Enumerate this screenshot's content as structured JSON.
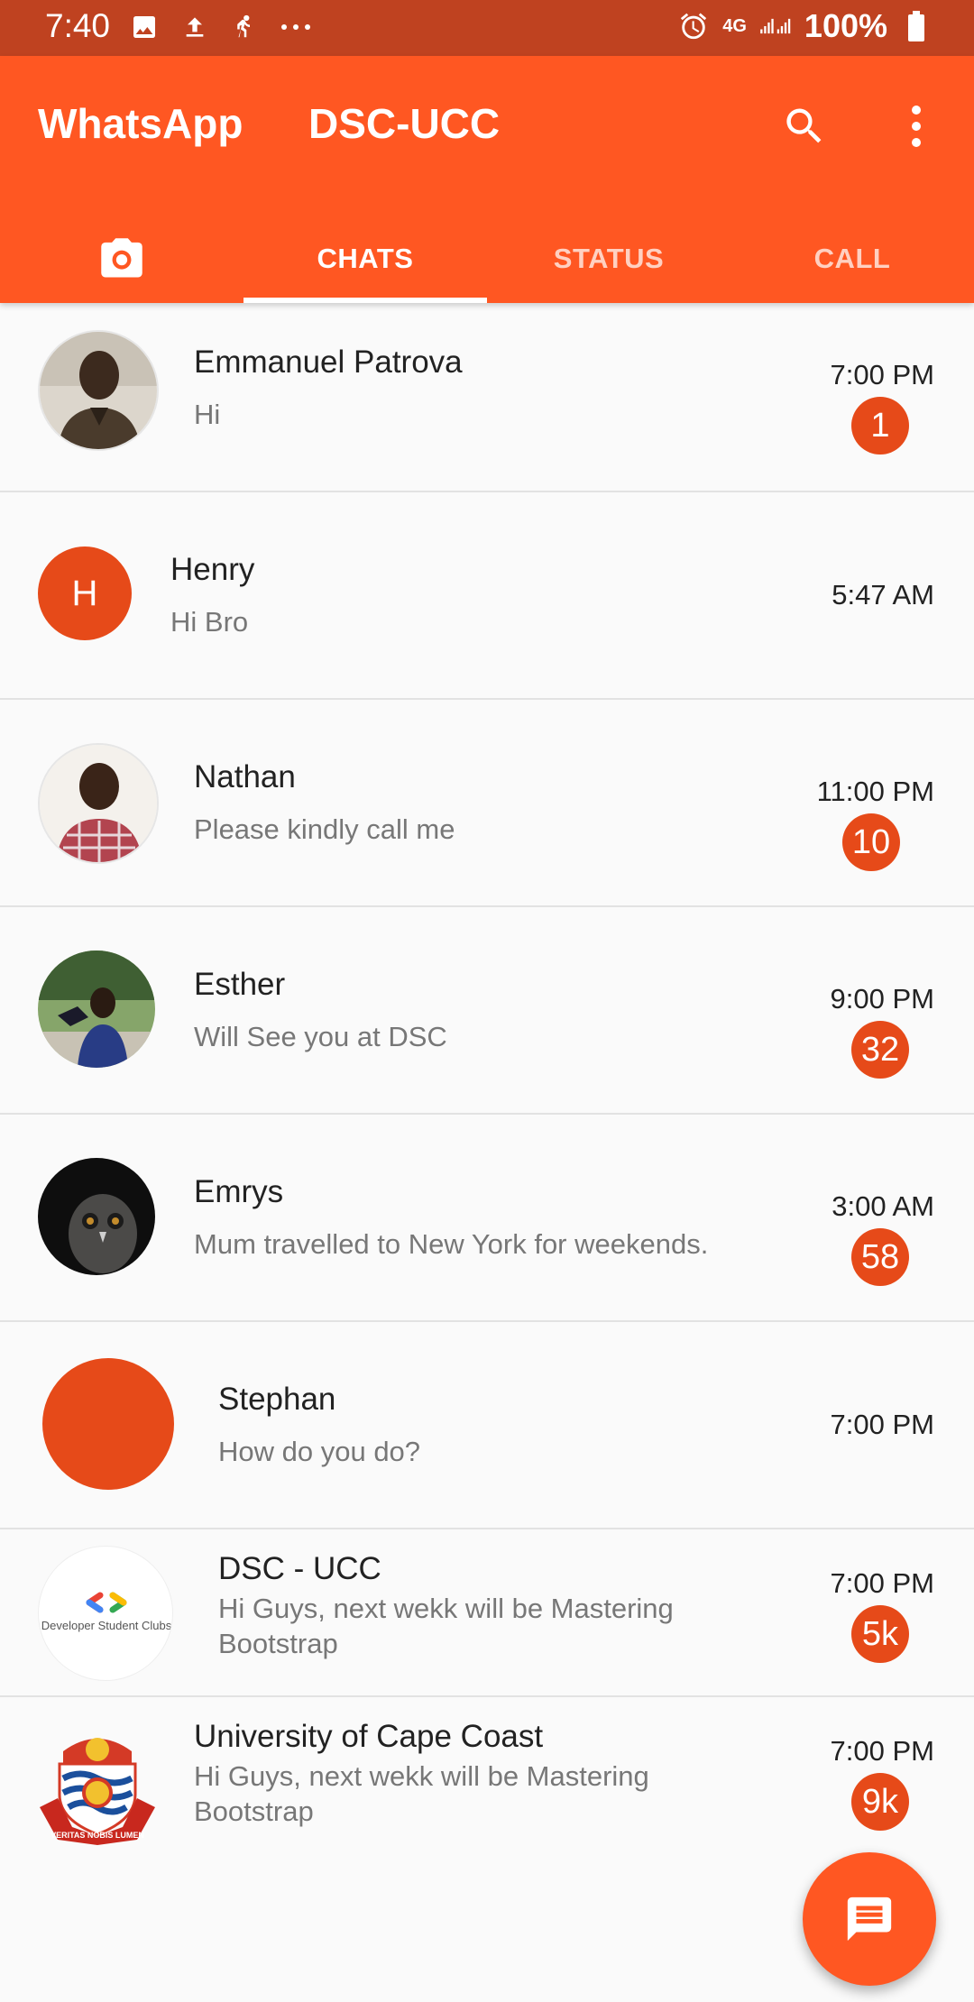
{
  "status_bar": {
    "time": "7:40",
    "network": "4G",
    "battery": "100%",
    "icons": [
      "image-icon",
      "upload-icon",
      "accessibility-icon",
      "more-dots-icon",
      "alarm-icon",
      "signal-icon",
      "battery-icon"
    ]
  },
  "header": {
    "app_name": "WhatsApp",
    "group_name": "DSC-UCC",
    "icons": [
      "search-icon",
      "more-vert-icon"
    ]
  },
  "tabs": [
    {
      "label": "",
      "icon": "camera-icon"
    },
    {
      "label": "CHATS",
      "active": true
    },
    {
      "label": "STATUS"
    },
    {
      "label": "CALL"
    }
  ],
  "chats": [
    {
      "name": "Emmanuel Patrova",
      "message": "Hi",
      "time": "7:00 PM",
      "unread": "1"
    },
    {
      "name": "Henry",
      "message": "Hi Bro",
      "time": "5:47 AM",
      "initial": "H"
    },
    {
      "name": "Nathan",
      "message": "Please kindly call me",
      "time": "11:00 PM",
      "unread": "10"
    },
    {
      "name": "Esther",
      "message": "Will See you at DSC",
      "time": "9:00 PM",
      "unread": "32"
    },
    {
      "name": "Emrys",
      "message": "Mum travelled to New York for weekends.",
      "time": "3:00 AM",
      "unread": "58"
    },
    {
      "name": "Stephan",
      "message": "How do you do?",
      "time": "7:00 PM"
    },
    {
      "name": "DSC - UCC",
      "message": "Hi Guys, next wekk will be Mastering Bootstrap",
      "time": "7:00 PM",
      "unread": "5k",
      "logo_text": "Developer Student Clubs"
    },
    {
      "name": "University of Cape Coast",
      "message": "Hi Guys, next wekk will be Mastering Bootstrap",
      "time": "7:00 PM",
      "unread": "9k",
      "logo_text": "VERITAS NOBIS LUMEN"
    }
  ],
  "fab": {
    "icon": "message-icon"
  },
  "colors": {
    "status_bar": "#bf4220",
    "primary": "#ff5722",
    "badge": "#e64a19",
    "background": "#fafafa"
  }
}
